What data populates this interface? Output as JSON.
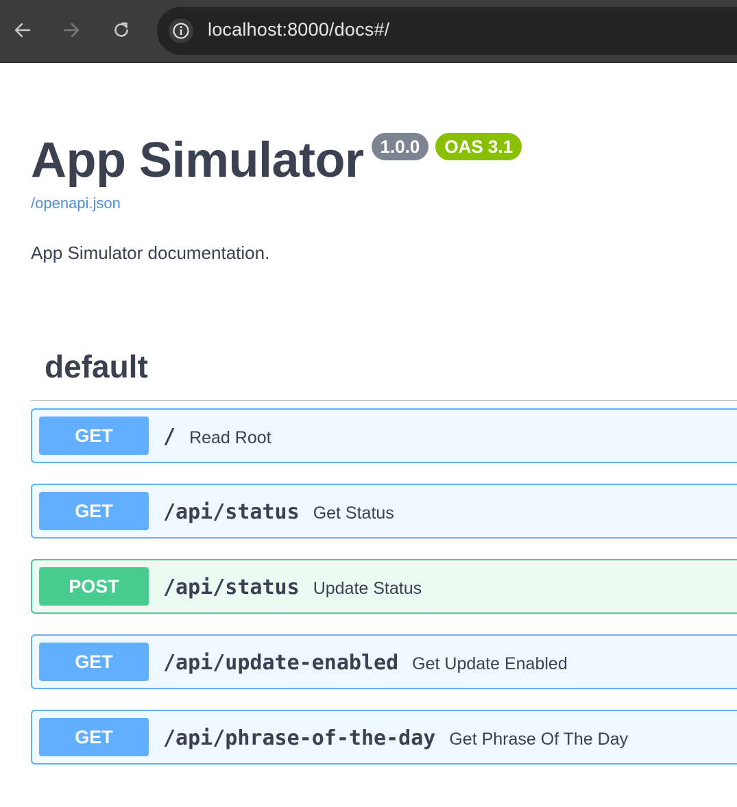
{
  "browser": {
    "url": "localhost:8000/docs#/"
  },
  "info": {
    "title": "App Simulator",
    "version": "1.0.0",
    "oas": "OAS 3.1",
    "spec_link": "/openapi.json",
    "description": "App Simulator documentation."
  },
  "tag": {
    "name": "default"
  },
  "operations": [
    {
      "method": "GET",
      "path": "/",
      "summary": "Read Root"
    },
    {
      "method": "GET",
      "path": "/api/status",
      "summary": "Get Status"
    },
    {
      "method": "POST",
      "path": "/api/status",
      "summary": "Update Status"
    },
    {
      "method": "GET",
      "path": "/api/update-enabled",
      "summary": "Get Update Enabled"
    },
    {
      "method": "GET",
      "path": "/api/phrase-of-the-day",
      "summary": "Get Phrase Of The Day"
    }
  ],
  "colors": {
    "get": "#61affe",
    "post": "#49cc90",
    "version_badge": "#7d8492",
    "oas_badge": "#89bf04",
    "link": "#4990e2",
    "text": "#3b4151"
  }
}
